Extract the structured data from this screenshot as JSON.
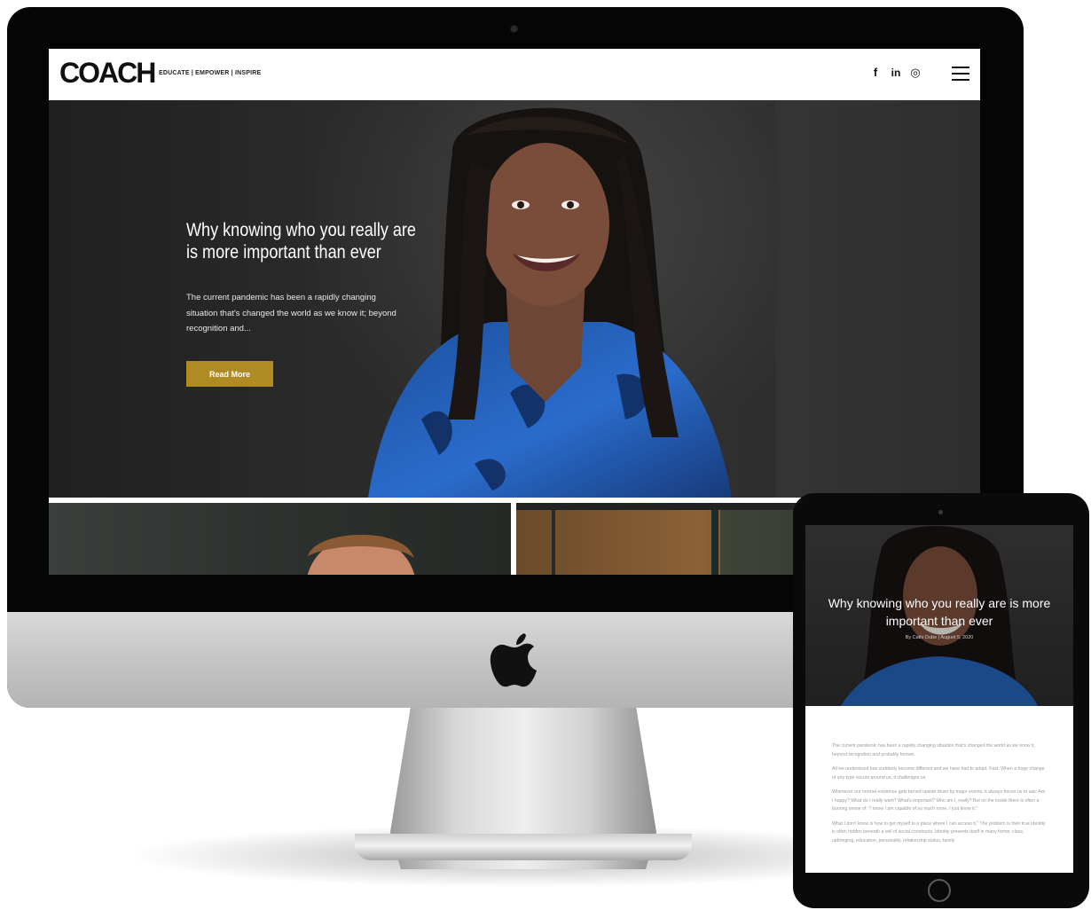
{
  "website": {
    "logo": "COACH",
    "tagline": "EDUCATE | EMPOWER | INSPIRE",
    "social": [
      {
        "icon": "facebook-icon",
        "glyph": "f"
      },
      {
        "icon": "linkedin-icon",
        "glyph": "in"
      },
      {
        "icon": "instagram-icon",
        "glyph": "◎"
      }
    ],
    "menu_icon": "hamburger-menu-icon",
    "hero": {
      "title": "Why knowing who you really are is more important than ever",
      "excerpt": "The current pandemic has been a rapidly changing situation that's changed the world as we know it; beyond recognition and...",
      "button_label": "Read More"
    }
  },
  "tablet": {
    "title": "Why knowing who you really are is more important than ever",
    "byline": "By Cathi Dube  |  August 5, 2020",
    "paragraphs": [
      "The current pandemic has been a rapidly changing situation that's changed the world as we know it, beyond recognition and probably forever.",
      "All we understood has suddenly become different and we have had to adapt. Fast. When a huge change of any type occurs around us, it challenges us.",
      "Whenever our normal existence gets turned upside down by major events, it always forces us to ask: Am I happy? What do I really want? What's important? Who am I, really? But on the inside there is often a burning sense of: \"I know I am capable of so much more, I just know it.\"",
      "What I don't know is how to get myself to a place where I can access it.\" The problem is their true identity is often hidden beneath a veil of social constructs. Identity presents itself in many forms: class, upbringing, education, personality, relationship status, family"
    ]
  },
  "colors": {
    "button": "#b08a22",
    "hero_bg": "#2c2c2c",
    "bezel": "#050505"
  }
}
